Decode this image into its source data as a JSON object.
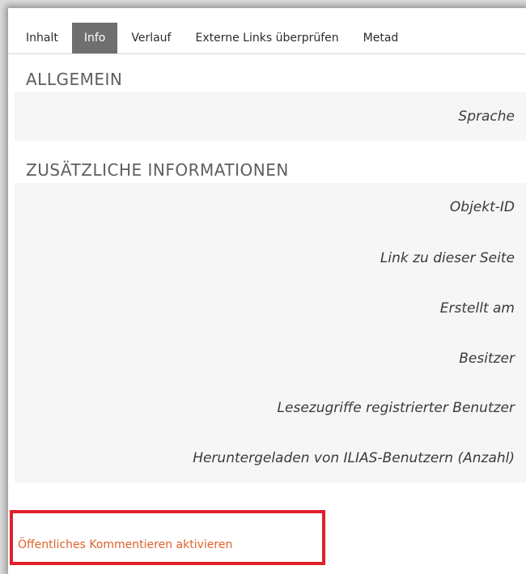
{
  "tabs": [
    {
      "label": "Inhalt",
      "active": false
    },
    {
      "label": "Info",
      "active": true
    },
    {
      "label": "Verlauf",
      "active": false
    },
    {
      "label": "Externe Links überprüfen",
      "active": false
    },
    {
      "label": "Metad",
      "active": false
    }
  ],
  "sections": {
    "general": {
      "title": "ALLGEMEIN",
      "properties": [
        "Sprache"
      ]
    },
    "additional": {
      "title": "ZUSÄTZLICHE INFORMATIONEN",
      "properties": [
        "Objekt-ID",
        "Link zu dieser Seite",
        "Erstellt am",
        "Besitzer",
        "Lesezugriffe registrierter Benutzer",
        "Heruntergeladen von ILIAS-Benutzern (Anzahl)"
      ]
    }
  },
  "actions": {
    "activate_comments": "Öffentliches Kommentieren aktivieren"
  },
  "colors": {
    "active_tab_bg": "#6f6f6f",
    "link": "#e0612a",
    "highlight_border": "#e0202a",
    "property_bg": "#f6f6f6"
  }
}
